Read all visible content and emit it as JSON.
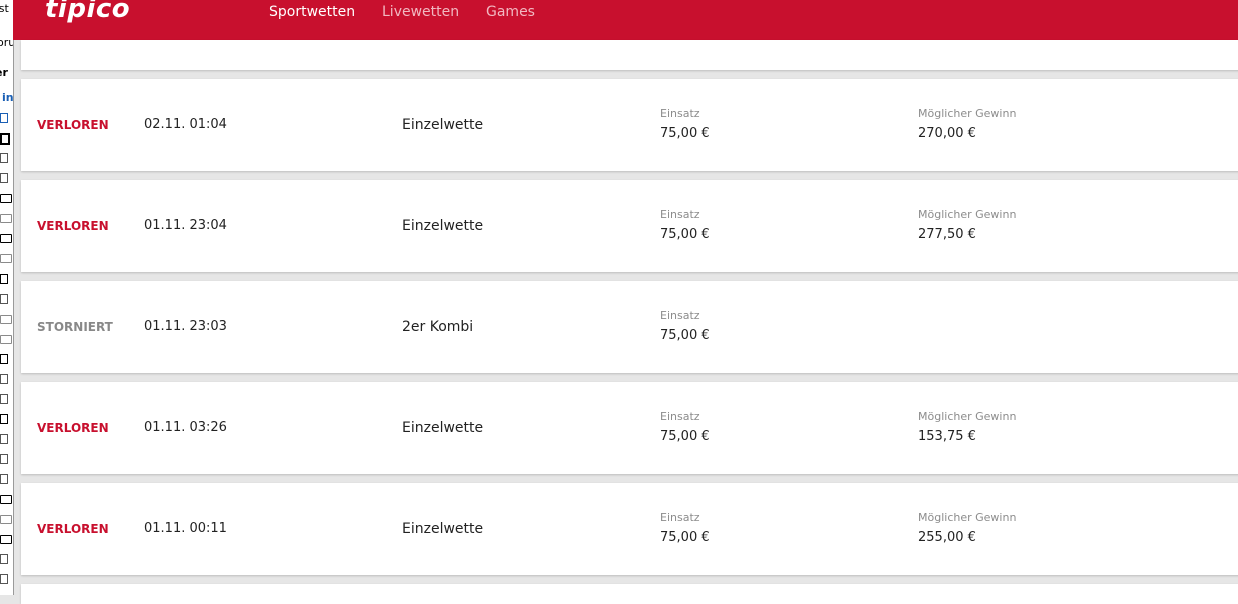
{
  "side_panel": {
    "texts": [
      "ost",
      "oru",
      "er",
      "in"
    ]
  },
  "header": {
    "logo": "tipico",
    "nav": [
      "Sportwetten",
      "Livewetten",
      "Games"
    ]
  },
  "labels": {
    "stake": "Einsatz",
    "possible_win": "Möglicher Gewinn"
  },
  "bets": [
    {
      "status": "VERLOREN",
      "datetime": "02.11. 01:04",
      "type": "Einzelwette",
      "stake": "75,00 €",
      "possible_win": "270,00 €"
    },
    {
      "status": "VERLOREN",
      "datetime": "01.11. 23:04",
      "type": "Einzelwette",
      "stake": "75,00 €",
      "possible_win": "277,50 €"
    },
    {
      "status": "STORNIERT",
      "datetime": "01.11. 23:03",
      "type": "2er Kombi",
      "stake": "75,00 €",
      "possible_win": ""
    },
    {
      "status": "VERLOREN",
      "datetime": "01.11. 03:26",
      "type": "Einzelwette",
      "stake": "75,00 €",
      "possible_win": "153,75 €"
    },
    {
      "status": "VERLOREN",
      "datetime": "01.11. 00:11",
      "type": "Einzelwette",
      "stake": "75,00 €",
      "possible_win": "255,00 €"
    }
  ],
  "colors": {
    "brand_red": "#c8102e",
    "lost": "#c8102e",
    "cancelled": "#888888",
    "label_grey": "#8c8c8c"
  }
}
